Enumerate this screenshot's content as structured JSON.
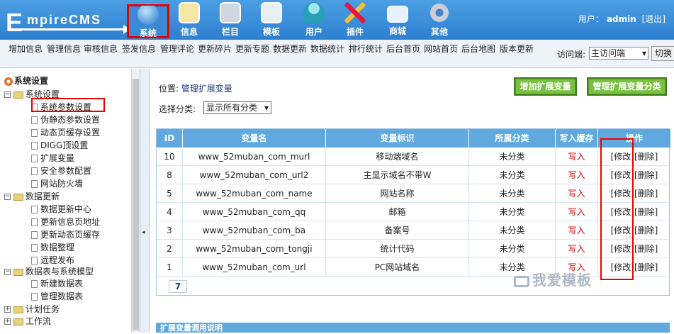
{
  "brand": {
    "text_e": "E",
    "text_rest": "mpireCMS"
  },
  "topnav": [
    {
      "label": "系统",
      "icon": "globe-icon",
      "active": true
    },
    {
      "label": "信息",
      "icon": "notepad-icon"
    },
    {
      "label": "栏目",
      "icon": "folder-icon"
    },
    {
      "label": "模板",
      "icon": "window-icon"
    },
    {
      "label": "用户",
      "icon": "user-icon"
    },
    {
      "label": "插件",
      "icon": "tools-icon"
    },
    {
      "label": "商城",
      "icon": "card-icon"
    },
    {
      "label": "其他",
      "icon": "gear-icon"
    }
  ],
  "user": {
    "prefix": "用户：",
    "name": "admin",
    "logout": "[退出]"
  },
  "subnav": [
    "增加信息",
    "管理信息",
    "审核信息",
    "签发信息",
    "管理评论",
    "更新碎片",
    "更新专题",
    "数据更新",
    "数据统计",
    "排行统计",
    "后台首页",
    "网站首页",
    "后台地图",
    "版本更新"
  ],
  "visit": {
    "label": "访问端:",
    "selected": "主访问端",
    "switch": "切换"
  },
  "tree": {
    "root": "系统设置",
    "groups": [
      {
        "label": "系统设置",
        "items": [
          "系统参数设置",
          "伪静态参数设置",
          "动态页缓存设置",
          "DIGG顶设置",
          "扩展变量",
          "安全参数配置",
          "网站防火墙"
        ]
      },
      {
        "label": "数据更新",
        "items": [
          "数据更新中心",
          "更新信息页地址",
          "更新动态页缓存",
          "数据整理",
          "远程发布"
        ]
      },
      {
        "label": "数据表与系统模型",
        "items": [
          "新建数据表",
          "管理数据表"
        ]
      },
      {
        "label": "计划任务",
        "items": []
      },
      {
        "label": "工作流",
        "items": []
      }
    ]
  },
  "main": {
    "location_prefix": "位置: ",
    "location_link": "管理扩展变量",
    "btn_add": "增加扩展变量",
    "btn_manage": "管理扩展变量分类",
    "category_label": "选择分类:",
    "category_value": "显示所有分类",
    "columns": [
      "ID",
      "变量名",
      "变量标识",
      "所属分类",
      "写入缓存",
      "操作"
    ],
    "rows": [
      {
        "id": "10",
        "name": "www_52muban_com_murl",
        "label": "移动端域名",
        "cat": "未分类",
        "cache": "写入",
        "edit": "[修改]",
        "del": "[删除]"
      },
      {
        "id": "8",
        "name": "www_52muban_com_url2",
        "label": "主显示域名不带W",
        "cat": "未分类",
        "cache": "写入",
        "edit": "[修改]",
        "del": "[删除]"
      },
      {
        "id": "5",
        "name": "www_52muban_com_name",
        "label": "网站名称",
        "cat": "未分类",
        "cache": "写入",
        "edit": "[修改]",
        "del": "[删除]"
      },
      {
        "id": "4",
        "name": "www_52muban_com_qq",
        "label": "邮箱",
        "cat": "未分类",
        "cache": "写入",
        "edit": "[修改]",
        "del": "[删除]"
      },
      {
        "id": "3",
        "name": "www_52muban_com_ba",
        "label": "备案号",
        "cat": "未分类",
        "cache": "写入",
        "edit": "[修改]",
        "del": "[删除]"
      },
      {
        "id": "2",
        "name": "www_52muban_com_tongji",
        "label": "统计代码",
        "cat": "未分类",
        "cache": "写入",
        "edit": "[修改]",
        "del": "[删除]"
      },
      {
        "id": "1",
        "name": "www_52muban_com_url",
        "label": "PC网站域名",
        "cat": "未分类",
        "cache": "写入",
        "edit": "[修改]",
        "del": "[删除]"
      }
    ],
    "page": "7",
    "bottom_title": "扩展变量调用说明",
    "watermark": "我爱模板"
  }
}
